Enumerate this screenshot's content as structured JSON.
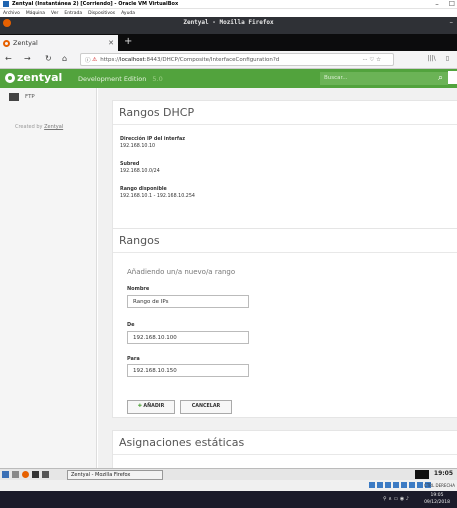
{
  "vbox": {
    "title": "Zentyal (Instantánea 2) [Corriendo] - Oracle VM VirtualBox",
    "menu": [
      "Archivo",
      "Máquina",
      "Ver",
      "Entrada",
      "Dispositivos",
      "Ayuda"
    ]
  },
  "firefox": {
    "window_title": "Zentyal - Mozilla Firefox",
    "tab_label": "Zentyal",
    "url_prefix": "https://",
    "url_host": "localhost",
    "url_path": ":8443/DHCP/Composite/InterfaceConfiguration?d",
    "url_actions": "··· ♡ ☆"
  },
  "zentyal": {
    "logo": "zentyal",
    "edition": "Development Edition",
    "version": "5.0",
    "search_placeholder": "Buscar..."
  },
  "sidebar": {
    "items": [
      {
        "label": "FTP"
      }
    ],
    "created_prefix": "Created by ",
    "created_link": "Zentyal"
  },
  "dhcp": {
    "title": "Rangos DHCP",
    "fields": [
      {
        "label": "Dirección IP del interfaz",
        "value": "192.168.10.10"
      },
      {
        "label": "Subred",
        "value": "192.168.10.0/24"
      },
      {
        "label": "Rango disponible",
        "value": "192.168.10.1 - 192.168.10.254"
      }
    ]
  },
  "ranges": {
    "title": "Rangos",
    "subtitle": "Añadiendo un/a nuevo/a rango",
    "name_label": "Nombre",
    "name_value": "Rango de IPs",
    "from_label": "De",
    "from_value": "192.168.10.100",
    "to_label": "Para",
    "to_value": "192.168.10.150",
    "add_button": "AÑADIR",
    "cancel_button": "CANCELAR"
  },
  "static": {
    "title": "Asignaciones estáticas"
  },
  "taskbar": {
    "task_label": "Zentyal - Mozilla Firefox",
    "clock": "19:05"
  },
  "host": {
    "hostkey": "CTRL DERECHA",
    "time": "19:05",
    "date": "09/12/2018"
  }
}
